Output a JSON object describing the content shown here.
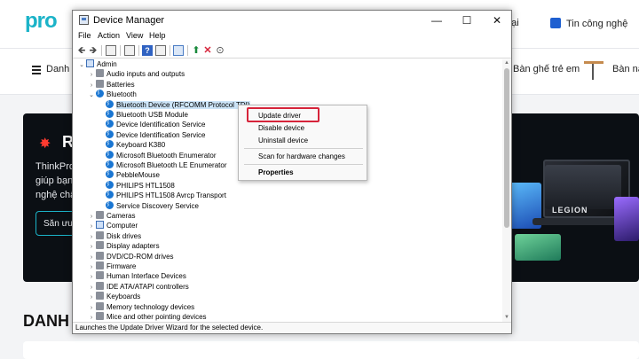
{
  "website": {
    "logo": "pro",
    "nav": [
      "nại",
      "Tin công nghệ"
    ],
    "menu": [
      "Danh m",
      "Bàn ghế trẻ em",
      "Bàn nâ"
    ],
    "banner": {
      "burst_icon": "burst-icon",
      "heading": "R",
      "lines": [
        "ThinkPro",
        "giúp bạn",
        "nghệ chấ"
      ],
      "button": "Săn ưu",
      "product_logo": "LEGION"
    },
    "section_title": "DANH"
  },
  "window": {
    "title": "Device Manager",
    "controls": {
      "minimize": "—",
      "maximize": "☐",
      "close": "✕"
    },
    "menu": [
      "File",
      "Action",
      "View",
      "Help"
    ],
    "tree": [
      {
        "label": "Admin",
        "icon": "computer-icon",
        "expanded": true
      },
      {
        "label": "Audio inputs and outputs",
        "icon": "speaker-icon"
      },
      {
        "label": "Batteries",
        "icon": "battery-icon"
      },
      {
        "label": "Bluetooth",
        "icon": "bluetooth-icon",
        "expanded": true
      },
      {
        "label": "Bluetooth Device (RFCOMM Protocol TDI)",
        "icon": "bluetooth-icon",
        "selected": true
      },
      {
        "label": "Bluetooth USB Module",
        "icon": "bluetooth-icon"
      },
      {
        "label": "Device Identification Service",
        "icon": "bluetooth-icon"
      },
      {
        "label": "Device Identification Service",
        "icon": "bluetooth-icon"
      },
      {
        "label": "Keyboard K380",
        "icon": "bluetooth-icon"
      },
      {
        "label": "Microsoft Bluetooth Enumerator",
        "icon": "bluetooth-icon"
      },
      {
        "label": "Microsoft Bluetooth LE Enumerator",
        "icon": "bluetooth-icon"
      },
      {
        "label": "PebbleMouse",
        "icon": "bluetooth-icon"
      },
      {
        "label": "PHILIPS HTL1508",
        "icon": "bluetooth-icon"
      },
      {
        "label": "PHILIPS HTL1508 Avrcp Transport",
        "icon": "bluetooth-icon"
      },
      {
        "label": "Service Discovery Service",
        "icon": "bluetooth-icon"
      },
      {
        "label": "Cameras",
        "icon": "camera-icon"
      },
      {
        "label": "Computer",
        "icon": "computer-icon"
      },
      {
        "label": "Disk drives",
        "icon": "disk-icon"
      },
      {
        "label": "Display adapters",
        "icon": "display-icon"
      },
      {
        "label": "DVD/CD-ROM drives",
        "icon": "dvd-icon"
      },
      {
        "label": "Firmware",
        "icon": "firmware-icon"
      },
      {
        "label": "Human Interface Devices",
        "icon": "hid-icon"
      },
      {
        "label": "IDE ATA/ATAPI controllers",
        "icon": "ide-icon"
      },
      {
        "label": "Keyboards",
        "icon": "keyboard-icon"
      },
      {
        "label": "Memory technology devices",
        "icon": "memory-icon"
      },
      {
        "label": "Mice and other pointing devices",
        "icon": "mouse-icon"
      }
    ],
    "status": "Launches the Update Driver Wizard for the selected device."
  },
  "context_menu": {
    "items": [
      "Update driver",
      "Disable device",
      "Uninstall device",
      "Scan for hardware changes",
      "Properties"
    ],
    "highlight_color": "#d6243a"
  }
}
